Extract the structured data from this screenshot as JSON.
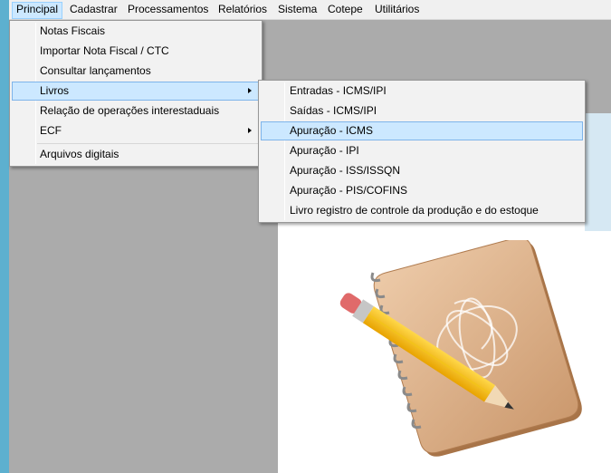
{
  "menubar": {
    "items": [
      "Principal",
      "Cadastrar",
      "Processamentos",
      "Relatórios",
      "Sistema",
      "Cotepe",
      "Utilitários"
    ]
  },
  "principal_menu": {
    "items": [
      {
        "label": "Notas Fiscais",
        "submenu": false
      },
      {
        "label": "Importar Nota Fiscal / CTC",
        "submenu": false
      },
      {
        "label": "Consultar lançamentos",
        "submenu": false
      },
      {
        "label": "Livros",
        "submenu": true
      },
      {
        "label": "Relação de operações interestaduais",
        "submenu": false
      },
      {
        "label": "ECF",
        "submenu": true
      },
      {
        "label": "Arquivos digitais",
        "submenu": false
      }
    ],
    "highlighted": "Livros"
  },
  "livros_submenu": {
    "items": [
      "Entradas - ICMS/IPI",
      "Saídas - ICMS/IPI",
      "Apuração - ICMS",
      "Apuração - IPI",
      "Apuração - ISS/ISSQN",
      "Apuração - PIS/COFINS",
      "Livro registro de controle da produção e do estoque"
    ],
    "highlighted": "Apuração - ICMS"
  },
  "icons": {
    "submenu_arrow": "chevron-right-icon",
    "illustration": "notebook-pencil-icon"
  },
  "colors": {
    "highlight_bg": "#cce8ff",
    "highlight_border": "#7eb4ea",
    "menu_bg": "#f2f2f2",
    "workspace_gray": "#ababab",
    "window_edge": "#5db0cf"
  }
}
